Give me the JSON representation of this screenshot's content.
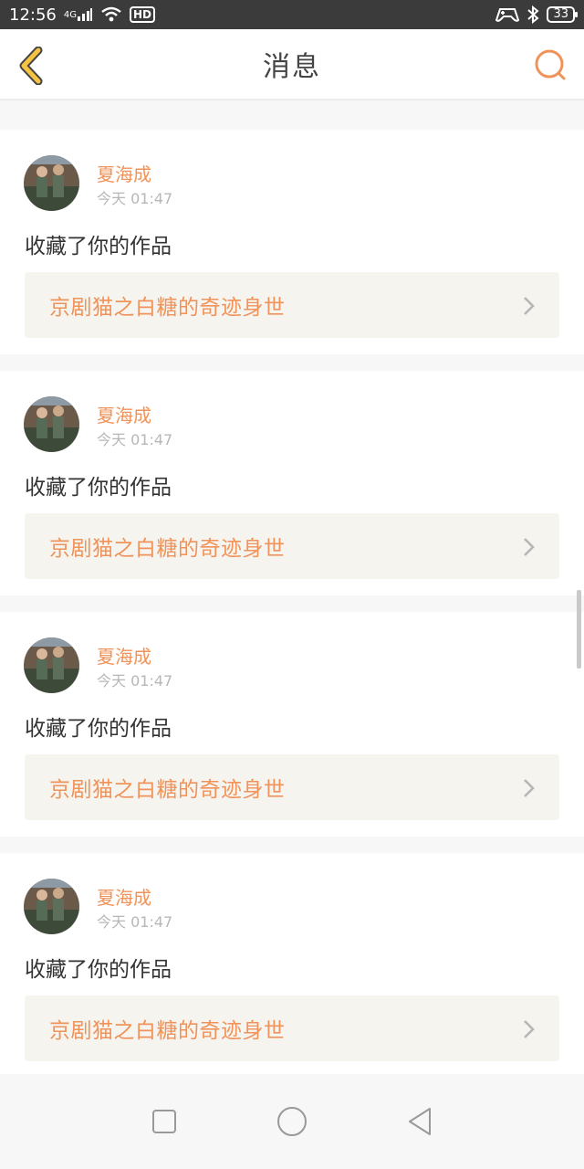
{
  "status_bar": {
    "time": "12:56",
    "network": "4G",
    "hd": "HD",
    "battery": "33",
    "icons": [
      "signal-icon",
      "wifi-icon",
      "hd-icon",
      "gamepad-icon",
      "bluetooth-icon",
      "battery-icon"
    ]
  },
  "header": {
    "title": "消息",
    "back_icon": "chevron-left-icon",
    "search_icon": "search-icon"
  },
  "messages": [
    {
      "user": "夏海成",
      "time": "今天 01:47",
      "action": "收藏了你的作品",
      "work": "京剧猫之白糖的奇迹身世"
    },
    {
      "user": "夏海成",
      "time": "今天 01:47",
      "action": "收藏了你的作品",
      "work": "京剧猫之白糖的奇迹身世"
    },
    {
      "user": "夏海成",
      "time": "今天 01:47",
      "action": "收藏了你的作品",
      "work": "京剧猫之白糖的奇迹身世"
    },
    {
      "user": "夏海成",
      "time": "今天 01:47",
      "action": "收藏了你的作品",
      "work": "京剧猫之白糖的奇迹身世"
    }
  ],
  "nav": {
    "icons": [
      "recent-apps-icon",
      "home-icon",
      "back-icon"
    ]
  },
  "colors": {
    "accent": "#f0935a",
    "back_icon": "#f5c242",
    "statusbar_bg": "#3b3b3b"
  }
}
